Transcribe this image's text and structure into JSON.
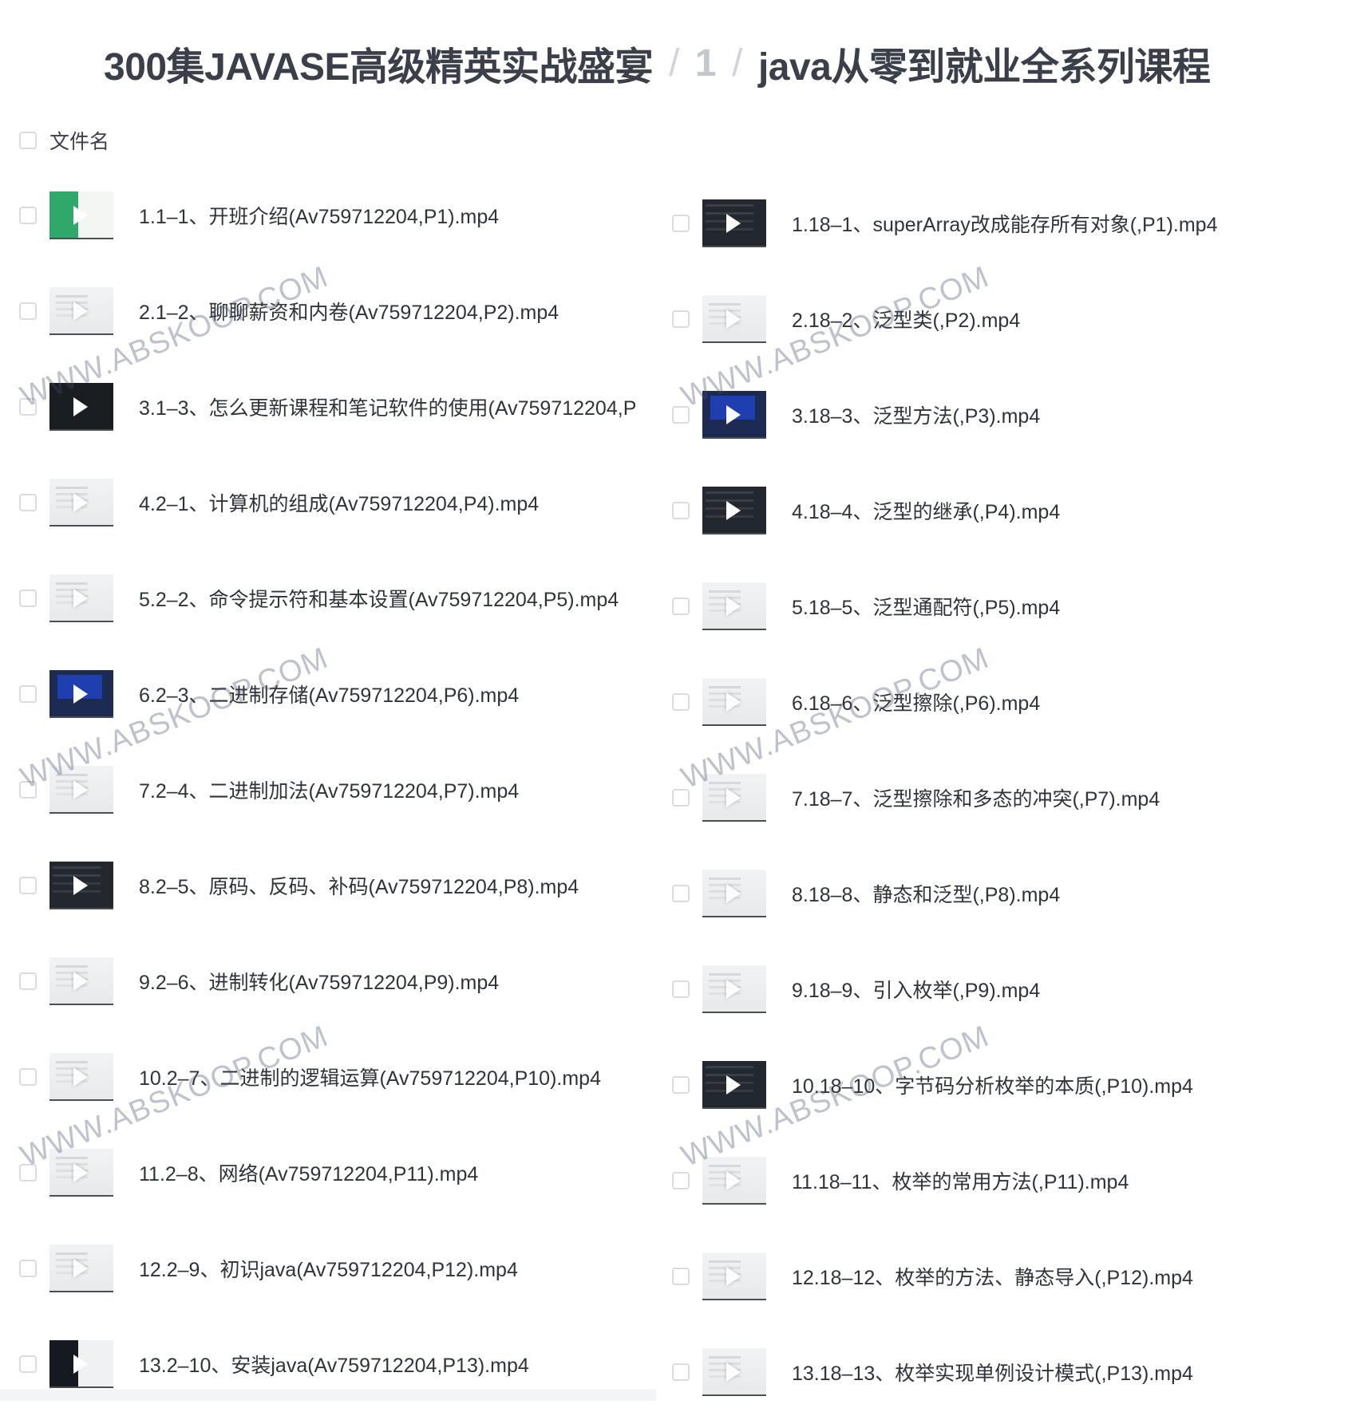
{
  "breadcrumb": {
    "root": "300集JAVASE高级精英实战盛宴",
    "separator": "/",
    "middle": "1",
    "current": "java从零到就业全系列课程"
  },
  "list_header": {
    "column_label": "文件名"
  },
  "files_left": [
    {
      "name": "1.1–1、开班介绍(Av759712204,P1).mp4",
      "thumb": "green"
    },
    {
      "name": "2.1–2、聊聊薪资和内卷(Av759712204,P2).mp4",
      "thumb": "light"
    },
    {
      "name": "3.1–3、怎么更新课程和笔记软件的使用(Av759712204,P",
      "thumb": "screen"
    },
    {
      "name": "4.2–1、计算机的组成(Av759712204,P4).mp4",
      "thumb": "light"
    },
    {
      "name": "5.2–2、命令提示符和基本设置(Av759712204,P5).mp4",
      "thumb": "light"
    },
    {
      "name": "6.2–3、二进制存储(Av759712204,P6).mp4",
      "thumb": "blue"
    },
    {
      "name": "7.2–4、二进制加法(Av759712204,P7).mp4",
      "thumb": "light"
    },
    {
      "name": "8.2–5、原码、反码、补码(Av759712204,P8).mp4",
      "thumb": "dark"
    },
    {
      "name": "9.2–6、进制转化(Av759712204,P9).mp4",
      "thumb": "light"
    },
    {
      "name": "10.2–7、二进制的逻辑运算(Av759712204,P10).mp4",
      "thumb": "light"
    },
    {
      "name": "11.2–8、网络(Av759712204,P11).mp4",
      "thumb": "light"
    },
    {
      "name": "12.2–9、初识java(Av759712204,P12).mp4",
      "thumb": "light"
    },
    {
      "name": "13.2–10、安装java(Av759712204,P13).mp4",
      "thumb": "mixed"
    }
  ],
  "files_right": [
    {
      "name": "1.18–1、superArray改成能存所有对象(,P1).mp4",
      "thumb": "dark"
    },
    {
      "name": "2.18–2、泛型类(,P2).mp4",
      "thumb": "light"
    },
    {
      "name": "3.18–3、泛型方法(,P3).mp4",
      "thumb": "blue"
    },
    {
      "name": "4.18–4、泛型的继承(,P4).mp4",
      "thumb": "dark"
    },
    {
      "name": "5.18–5、泛型通配符(,P5).mp4",
      "thumb": "light"
    },
    {
      "name": "6.18–6、泛型擦除(,P6).mp4",
      "thumb": "light"
    },
    {
      "name": "7.18–7、泛型擦除和多态的冲突(,P7).mp4",
      "thumb": "light"
    },
    {
      "name": "8.18–8、静态和泛型(,P8).mp4",
      "thumb": "light"
    },
    {
      "name": "9.18–9、引入枚举(,P9).mp4",
      "thumb": "light"
    },
    {
      "name": "10.18–10、字节码分析枚举的本质(,P10).mp4",
      "thumb": "dark"
    },
    {
      "name": "11.18–11、枚举的常用方法(,P11).mp4",
      "thumb": "light"
    },
    {
      "name": "12.18–12、枚举的方法、静态导入(,P12).mp4",
      "thumb": "light"
    },
    {
      "name": "13.18–13、枚举实现单例设计模式(,P13).mp4",
      "thumb": "light"
    }
  ],
  "watermark": {
    "text": "WWW.ABSKOOP.COM"
  },
  "colors": {
    "text": "#2f333a",
    "title": "#3a3f4a",
    "separator": "#d0d4da",
    "checkbox_border": "#d9dce1"
  },
  "icons": {
    "play": "play-icon",
    "checkbox": "checkbox"
  }
}
